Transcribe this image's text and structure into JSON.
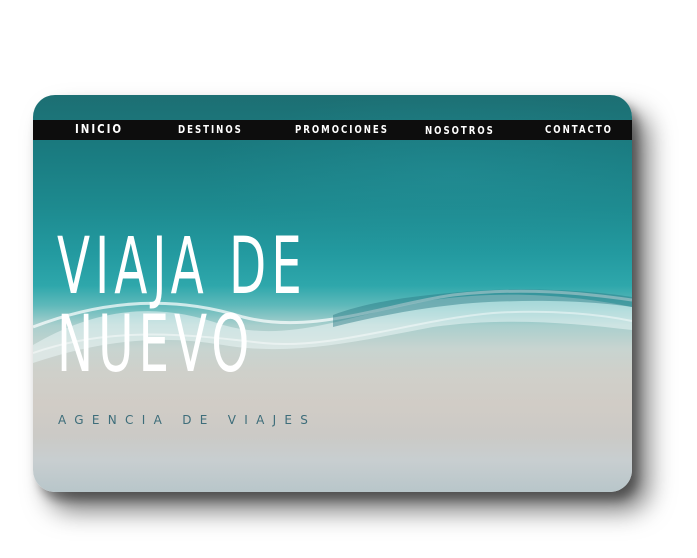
{
  "nav": {
    "items": [
      {
        "label": "INICIO"
      },
      {
        "label": "DESTINOS"
      },
      {
        "label": "PROMOCIONES"
      },
      {
        "label": "NOSOTROS"
      },
      {
        "label": "CONTACTO"
      }
    ]
  },
  "hero": {
    "headline_line1": "VIAJA DE",
    "headline_line2": "NUEVO",
    "tagline": "AGENCIA DE VIAJES",
    "image": "aerial-beach-waves-photo"
  },
  "colors": {
    "nav_bg": "#0d0d0d",
    "headline": "#ffffff",
    "tagline": "#3d6d7a",
    "sea": "#1d8a8f",
    "sand": "#d1ccc6"
  }
}
